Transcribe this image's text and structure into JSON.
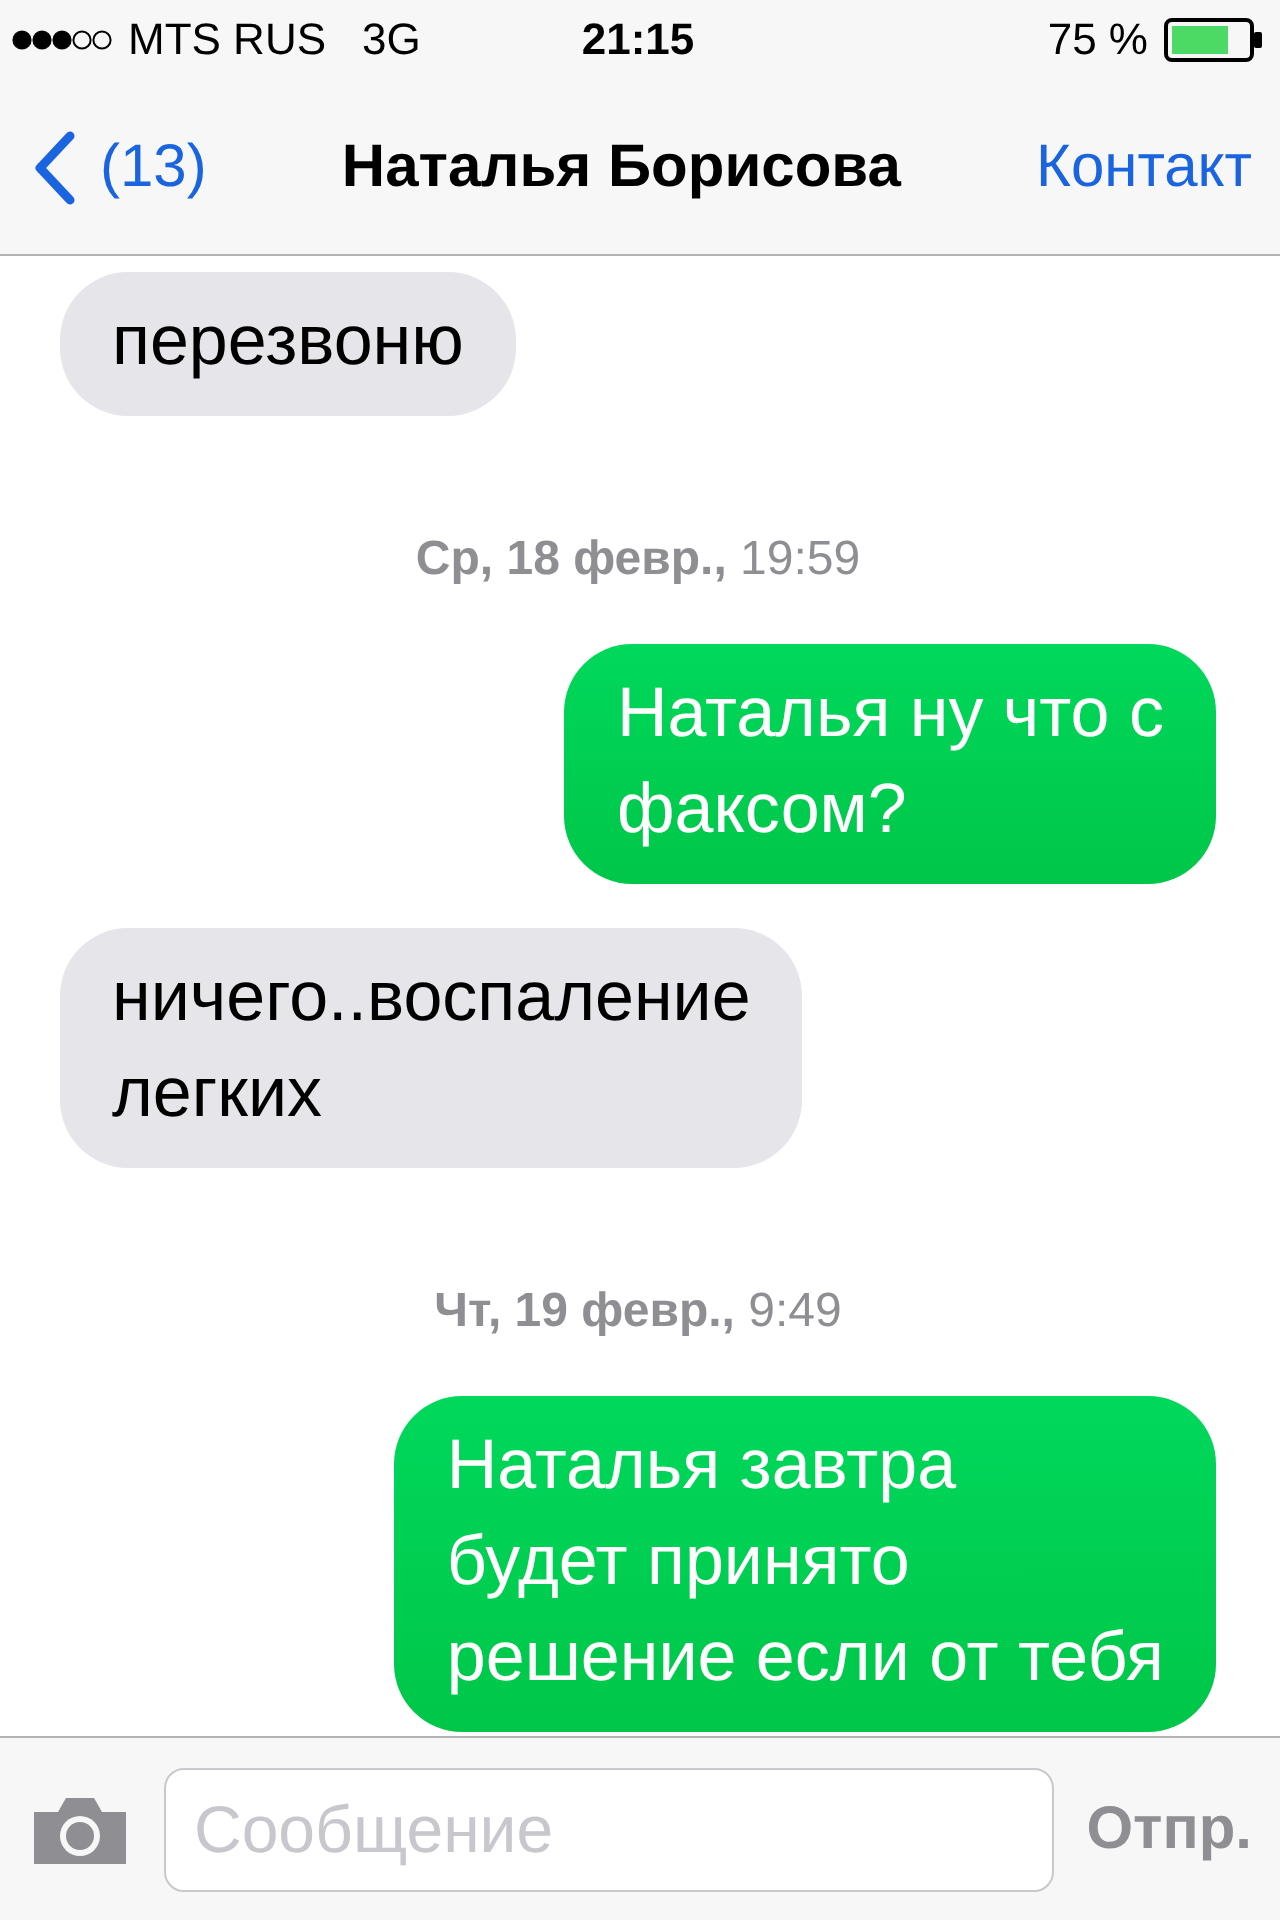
{
  "status_bar": {
    "carrier": "MTS RUS",
    "network": "3G",
    "time": "21:15",
    "battery": "75 %"
  },
  "nav_bar": {
    "back_count": "(13)",
    "title": "Наталья Борисова",
    "action": "Контакт"
  },
  "messages": [
    {
      "kind": "received",
      "text": "перезвоню"
    },
    {
      "kind": "timestamp",
      "text": "**Ср, 18 февр.,** 19:59"
    },
    {
      "kind": "sent",
      "text": "Наталья ну что с\nфаксом?"
    },
    {
      "kind": "received",
      "text": "ничего..воспаление\nлегких"
    },
    {
      "kind": "timestamp",
      "text": "**Чт, 19 февр.,** 9:49"
    },
    {
      "kind": "sent",
      "text": "Наталья завтра\nбудет принято\nрешение если от тебя"
    }
  ],
  "input_bar": {
    "placeholder": "Сообщение",
    "send": "Отпр."
  }
}
